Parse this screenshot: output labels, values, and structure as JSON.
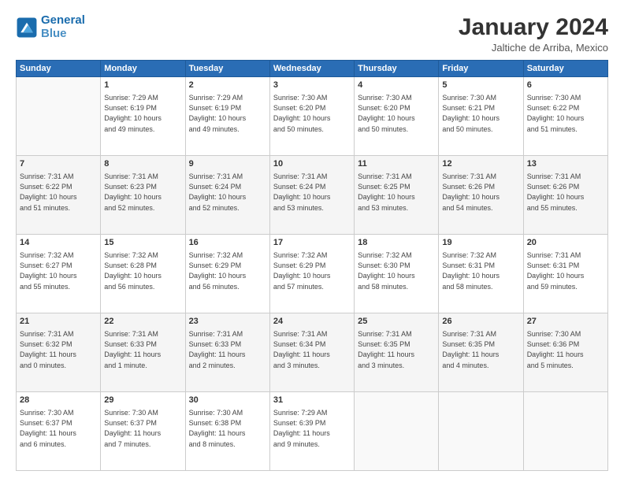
{
  "logo": {
    "line1": "General",
    "line2": "Blue"
  },
  "title": "January 2024",
  "subtitle": "Jaltiche de Arriba, Mexico",
  "columns": [
    "Sunday",
    "Monday",
    "Tuesday",
    "Wednesday",
    "Thursday",
    "Friday",
    "Saturday"
  ],
  "weeks": [
    [
      {
        "day": "",
        "info": ""
      },
      {
        "day": "1",
        "info": "Sunrise: 7:29 AM\nSunset: 6:19 PM\nDaylight: 10 hours\nand 49 minutes."
      },
      {
        "day": "2",
        "info": "Sunrise: 7:29 AM\nSunset: 6:19 PM\nDaylight: 10 hours\nand 49 minutes."
      },
      {
        "day": "3",
        "info": "Sunrise: 7:30 AM\nSunset: 6:20 PM\nDaylight: 10 hours\nand 50 minutes."
      },
      {
        "day": "4",
        "info": "Sunrise: 7:30 AM\nSunset: 6:20 PM\nDaylight: 10 hours\nand 50 minutes."
      },
      {
        "day": "5",
        "info": "Sunrise: 7:30 AM\nSunset: 6:21 PM\nDaylight: 10 hours\nand 50 minutes."
      },
      {
        "day": "6",
        "info": "Sunrise: 7:30 AM\nSunset: 6:22 PM\nDaylight: 10 hours\nand 51 minutes."
      }
    ],
    [
      {
        "day": "7",
        "info": "Sunrise: 7:31 AM\nSunset: 6:22 PM\nDaylight: 10 hours\nand 51 minutes."
      },
      {
        "day": "8",
        "info": "Sunrise: 7:31 AM\nSunset: 6:23 PM\nDaylight: 10 hours\nand 52 minutes."
      },
      {
        "day": "9",
        "info": "Sunrise: 7:31 AM\nSunset: 6:24 PM\nDaylight: 10 hours\nand 52 minutes."
      },
      {
        "day": "10",
        "info": "Sunrise: 7:31 AM\nSunset: 6:24 PM\nDaylight: 10 hours\nand 53 minutes."
      },
      {
        "day": "11",
        "info": "Sunrise: 7:31 AM\nSunset: 6:25 PM\nDaylight: 10 hours\nand 53 minutes."
      },
      {
        "day": "12",
        "info": "Sunrise: 7:31 AM\nSunset: 6:26 PM\nDaylight: 10 hours\nand 54 minutes."
      },
      {
        "day": "13",
        "info": "Sunrise: 7:31 AM\nSunset: 6:26 PM\nDaylight: 10 hours\nand 55 minutes."
      }
    ],
    [
      {
        "day": "14",
        "info": "Sunrise: 7:32 AM\nSunset: 6:27 PM\nDaylight: 10 hours\nand 55 minutes."
      },
      {
        "day": "15",
        "info": "Sunrise: 7:32 AM\nSunset: 6:28 PM\nDaylight: 10 hours\nand 56 minutes."
      },
      {
        "day": "16",
        "info": "Sunrise: 7:32 AM\nSunset: 6:29 PM\nDaylight: 10 hours\nand 56 minutes."
      },
      {
        "day": "17",
        "info": "Sunrise: 7:32 AM\nSunset: 6:29 PM\nDaylight: 10 hours\nand 57 minutes."
      },
      {
        "day": "18",
        "info": "Sunrise: 7:32 AM\nSunset: 6:30 PM\nDaylight: 10 hours\nand 58 minutes."
      },
      {
        "day": "19",
        "info": "Sunrise: 7:32 AM\nSunset: 6:31 PM\nDaylight: 10 hours\nand 58 minutes."
      },
      {
        "day": "20",
        "info": "Sunrise: 7:31 AM\nSunset: 6:31 PM\nDaylight: 10 hours\nand 59 minutes."
      }
    ],
    [
      {
        "day": "21",
        "info": "Sunrise: 7:31 AM\nSunset: 6:32 PM\nDaylight: 11 hours\nand 0 minutes."
      },
      {
        "day": "22",
        "info": "Sunrise: 7:31 AM\nSunset: 6:33 PM\nDaylight: 11 hours\nand 1 minute."
      },
      {
        "day": "23",
        "info": "Sunrise: 7:31 AM\nSunset: 6:33 PM\nDaylight: 11 hours\nand 2 minutes."
      },
      {
        "day": "24",
        "info": "Sunrise: 7:31 AM\nSunset: 6:34 PM\nDaylight: 11 hours\nand 3 minutes."
      },
      {
        "day": "25",
        "info": "Sunrise: 7:31 AM\nSunset: 6:35 PM\nDaylight: 11 hours\nand 3 minutes."
      },
      {
        "day": "26",
        "info": "Sunrise: 7:31 AM\nSunset: 6:35 PM\nDaylight: 11 hours\nand 4 minutes."
      },
      {
        "day": "27",
        "info": "Sunrise: 7:30 AM\nSunset: 6:36 PM\nDaylight: 11 hours\nand 5 minutes."
      }
    ],
    [
      {
        "day": "28",
        "info": "Sunrise: 7:30 AM\nSunset: 6:37 PM\nDaylight: 11 hours\nand 6 minutes."
      },
      {
        "day": "29",
        "info": "Sunrise: 7:30 AM\nSunset: 6:37 PM\nDaylight: 11 hours\nand 7 minutes."
      },
      {
        "day": "30",
        "info": "Sunrise: 7:30 AM\nSunset: 6:38 PM\nDaylight: 11 hours\nand 8 minutes."
      },
      {
        "day": "31",
        "info": "Sunrise: 7:29 AM\nSunset: 6:39 PM\nDaylight: 11 hours\nand 9 minutes."
      },
      {
        "day": "",
        "info": ""
      },
      {
        "day": "",
        "info": ""
      },
      {
        "day": "",
        "info": ""
      }
    ]
  ]
}
